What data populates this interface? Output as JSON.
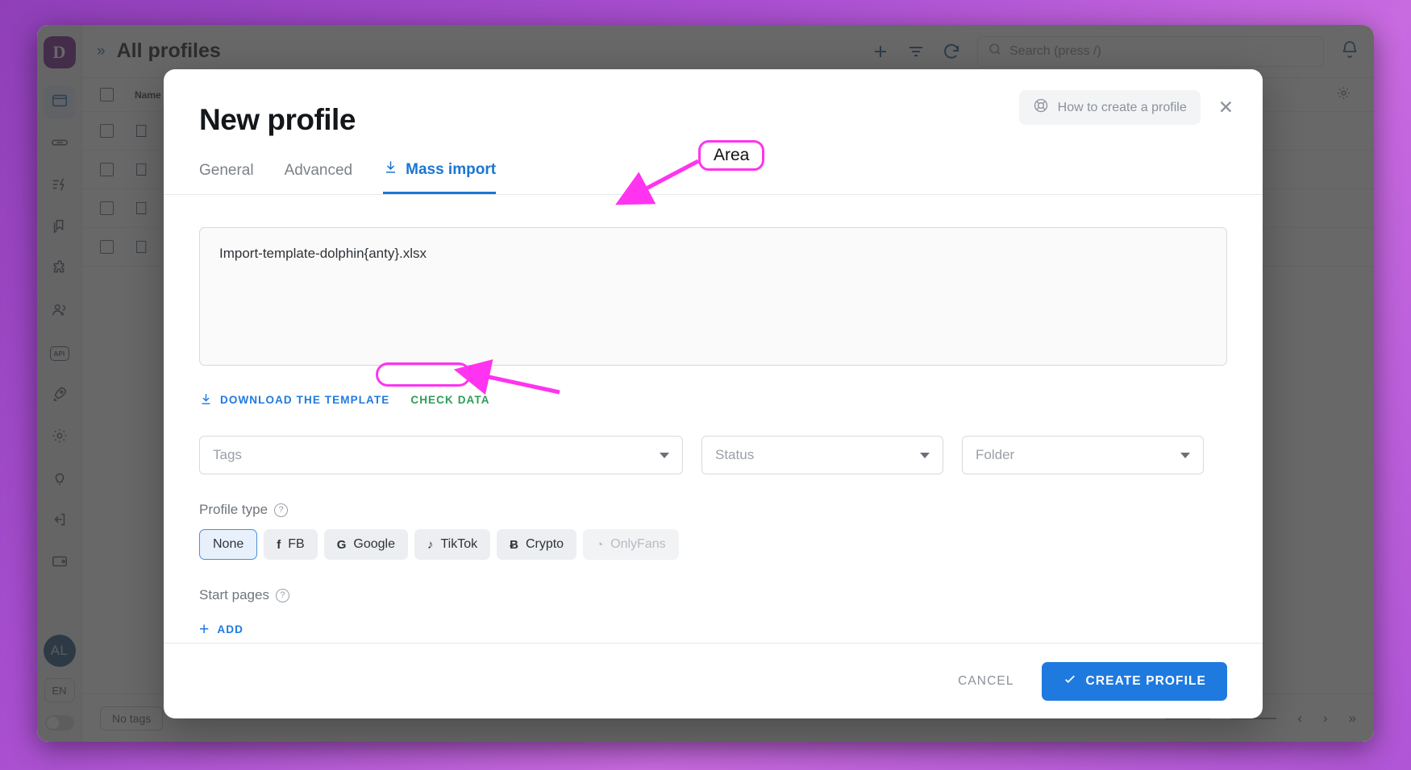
{
  "app": {
    "header": {
      "expand_icon": "chevron-double-right-icon",
      "title": "All profiles",
      "actions": [
        "plus-icon",
        "filter-icon",
        "refresh-icon"
      ],
      "search_placeholder": "Search (press /)",
      "notifications_icon": "bell-icon"
    },
    "sidebar": {
      "logo": "D",
      "items": [
        {
          "icon": "browser-profiles-icon",
          "active": true
        },
        {
          "icon": "link-icon",
          "active": false
        },
        {
          "icon": "automation-icon",
          "active": false
        },
        {
          "icon": "copy-icon",
          "active": false
        },
        {
          "icon": "extensions-puzzle-icon",
          "active": false
        },
        {
          "icon": "team-icon",
          "active": false
        },
        {
          "icon": "api-icon",
          "label": "API",
          "active": false
        },
        {
          "icon": "rocket-icon",
          "active": false
        },
        {
          "icon": "gear-icon",
          "active": false
        },
        {
          "icon": "bulb-icon",
          "active": false
        },
        {
          "icon": "logout-icon",
          "active": false
        },
        {
          "icon": "wallet-icon",
          "active": false
        }
      ],
      "avatar": "AL",
      "language": "EN",
      "theme_toggle": "theme-toggle"
    },
    "table": {
      "columns": [
        "checkbox",
        "Name"
      ],
      "rows": [
        {
          "platform_icon": "apple-icon"
        },
        {
          "platform_icon": "apple-icon"
        },
        {
          "platform_icon": "apple-icon"
        },
        {
          "platform_icon": "apple-icon"
        }
      ],
      "settings_icon": "gear-icon"
    },
    "footer": {
      "tag_filter": "No tags",
      "pager": {
        "prev": "‹",
        "next": "›",
        "last": "»"
      }
    }
  },
  "modal": {
    "title": "New profile",
    "help_button": {
      "icon": "lifebuoy-icon",
      "label": "How to create a profile"
    },
    "close_icon": "close-icon",
    "tabs": [
      {
        "label": "General",
        "active": false,
        "icon": null
      },
      {
        "label": "Advanced",
        "active": false,
        "icon": null
      },
      {
        "label": "Mass import",
        "active": true,
        "icon": "download-icon"
      }
    ],
    "file_area": {
      "value": "Import-template-dolphin{anty}.xlsx"
    },
    "actions": {
      "download_template": {
        "label": "DOWNLOAD THE TEMPLATE",
        "icon": "download-icon",
        "color": "#1f7ae0"
      },
      "check_data": {
        "label": "CHECK DATA",
        "color": "#2e9e57"
      }
    },
    "selects": [
      {
        "name": "tags",
        "placeholder": "Tags"
      },
      {
        "name": "status",
        "placeholder": "Status"
      },
      {
        "name": "folder",
        "placeholder": "Folder"
      }
    ],
    "profile_type": {
      "label": "Profile type",
      "help_icon": "question-icon",
      "options": [
        {
          "label": "None",
          "icon": null,
          "selected": true,
          "disabled": false
        },
        {
          "label": "FB",
          "icon": "facebook-icon",
          "glyph": "f",
          "selected": false,
          "disabled": false
        },
        {
          "label": "Google",
          "icon": "google-icon",
          "glyph": "G",
          "selected": false,
          "disabled": false
        },
        {
          "label": "TikTok",
          "icon": "tiktok-icon",
          "glyph": "♪",
          "selected": false,
          "disabled": false
        },
        {
          "label": "Crypto",
          "icon": "bitcoin-icon",
          "glyph": "Ƀ",
          "selected": false,
          "disabled": false
        },
        {
          "label": "OnlyFans",
          "icon": "onlyfans-icon",
          "glyph": "◔",
          "selected": false,
          "disabled": true
        }
      ]
    },
    "start_pages": {
      "label": "Start pages",
      "help_icon": "question-icon",
      "add_label": "ADD",
      "add_icon": "plus-icon"
    },
    "footer": {
      "cancel_label": "CANCEL",
      "create_label": "CREATE PROFILE",
      "create_icon": "check-icon",
      "create_color": "#1f7ae0"
    }
  },
  "annotations": {
    "area_label": "Area",
    "highlight_color": "#ff33f0",
    "arrow_to_tabs": "arrow-icon",
    "arrow_to_check_data": "arrow-icon"
  }
}
